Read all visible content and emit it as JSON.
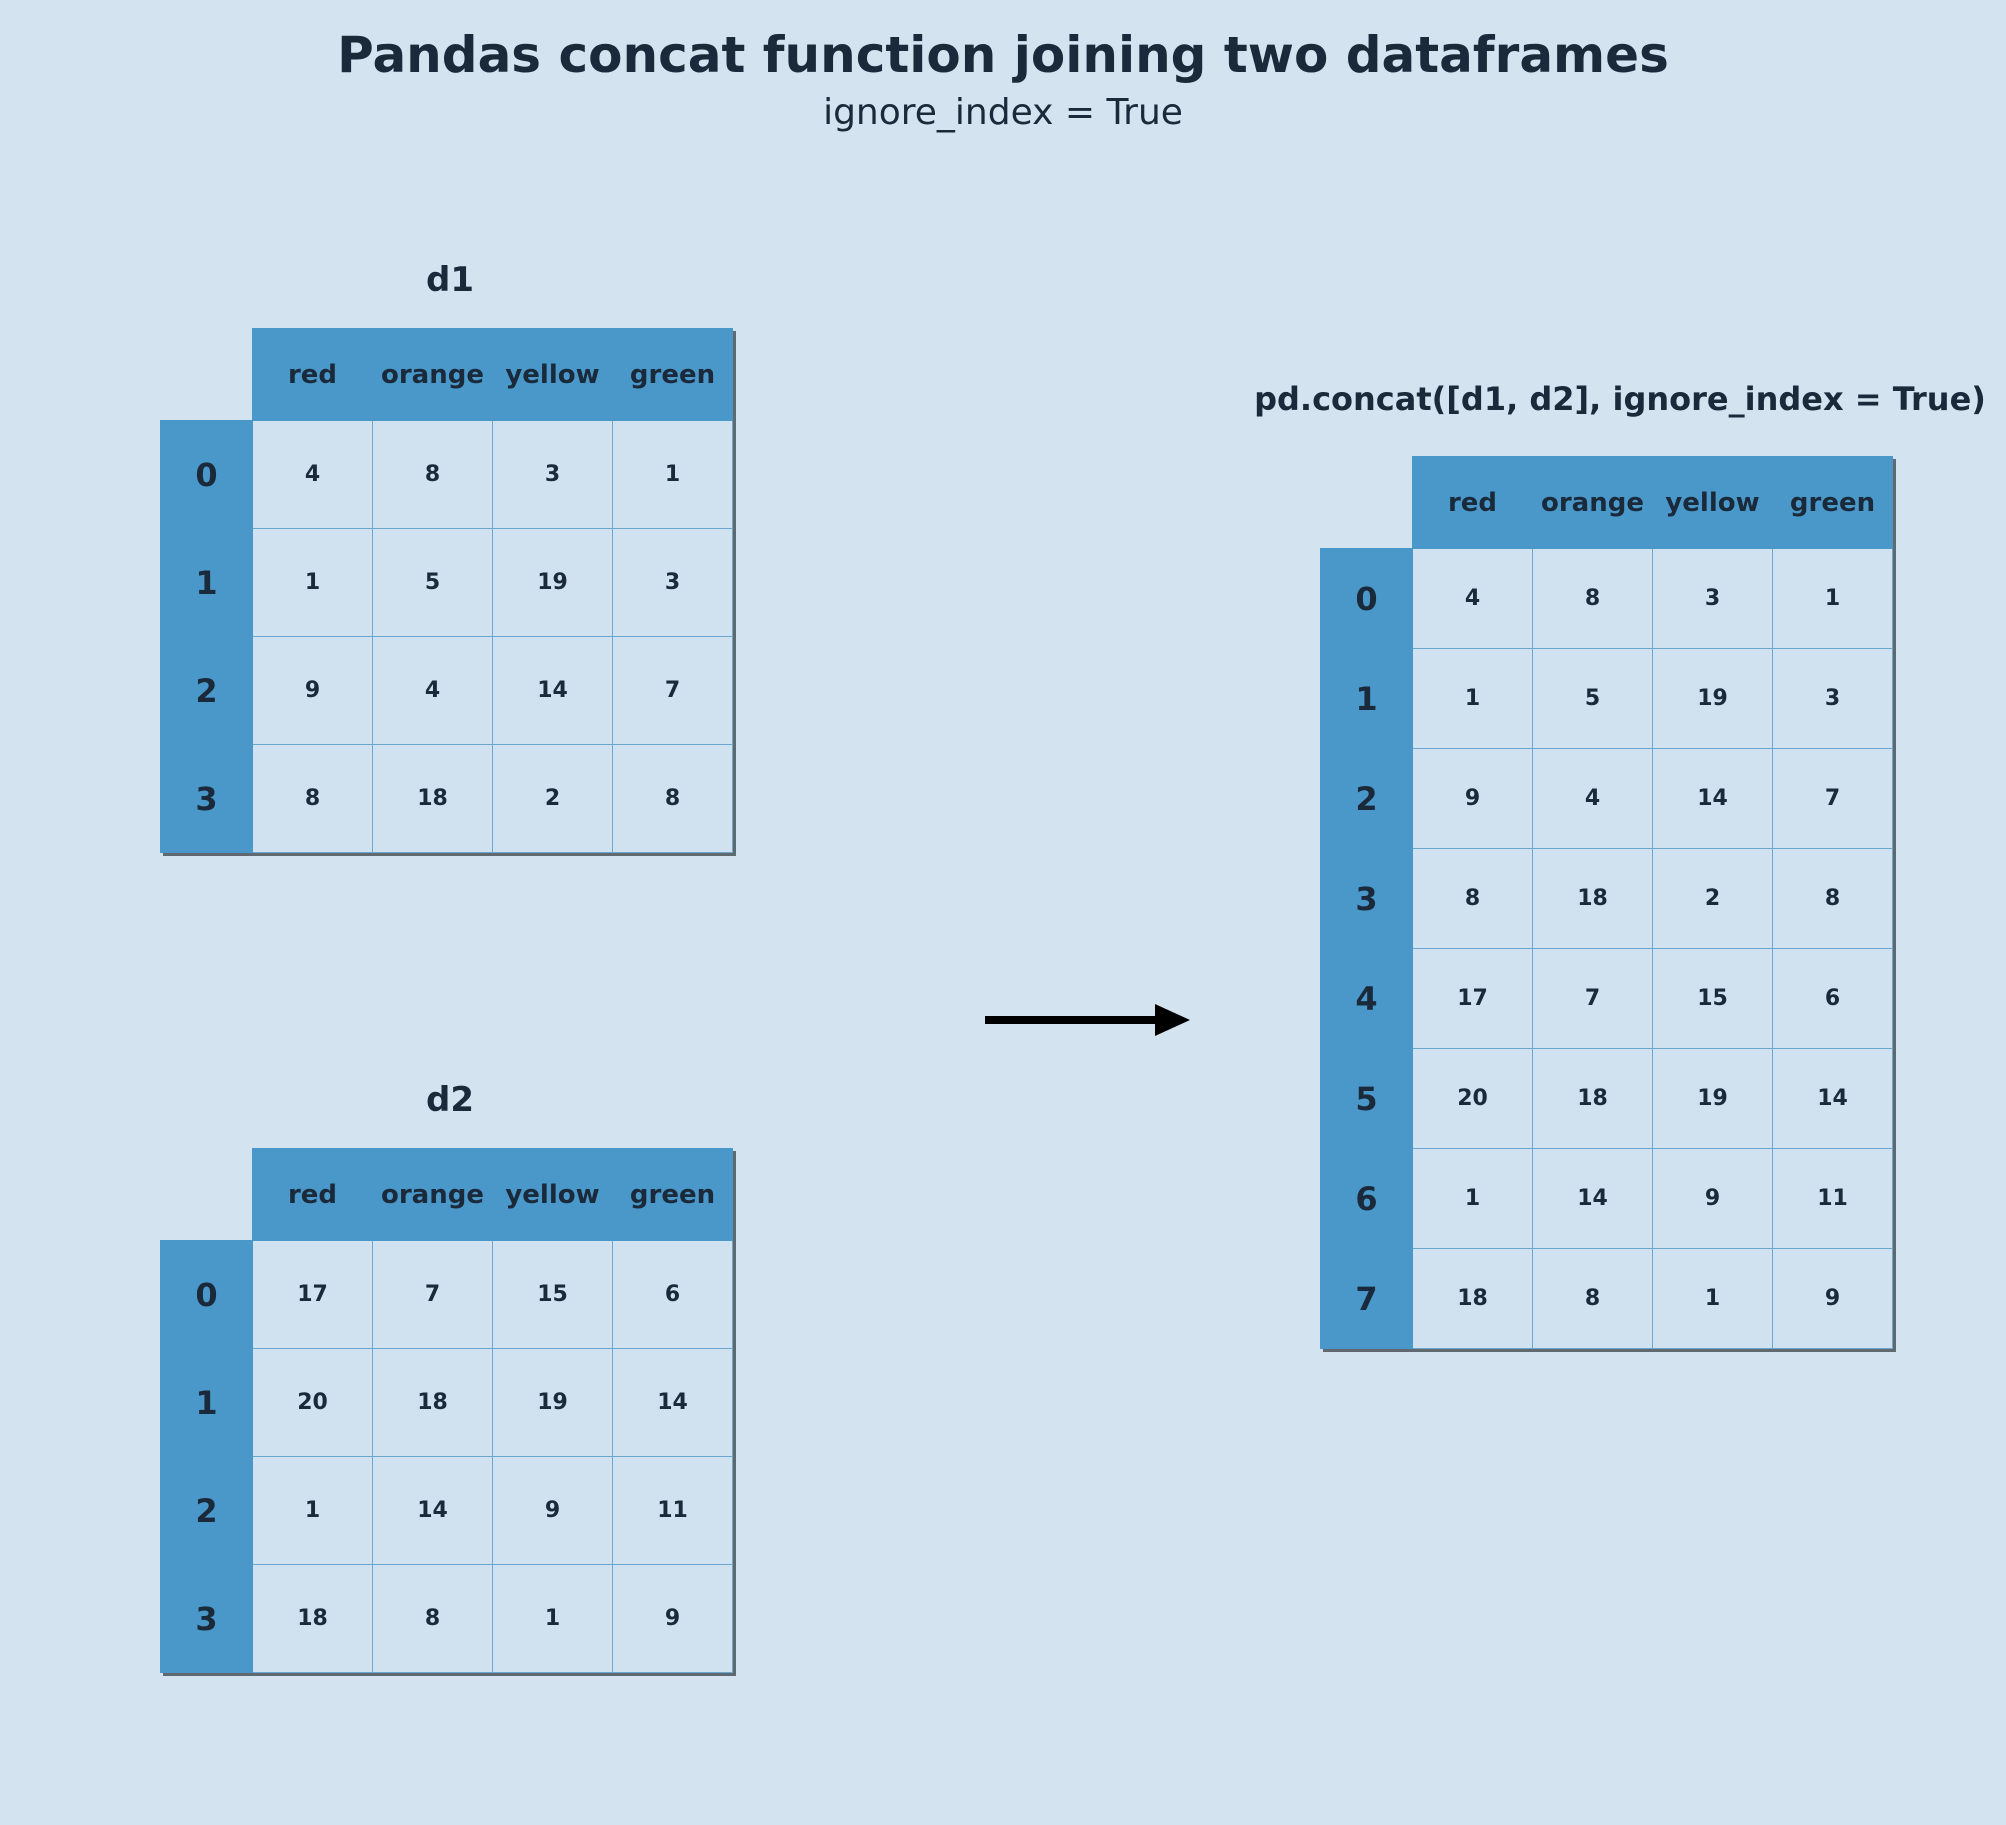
{
  "title": "Pandas concat function joining two dataframes",
  "subtitle": "ignore_index = True",
  "columns": [
    "red",
    "orange",
    "yellow",
    "green"
  ],
  "d1": {
    "label": "d1",
    "index": [
      "0",
      "1",
      "2",
      "3"
    ],
    "rows": [
      [
        "4",
        "8",
        "3",
        "1"
      ],
      [
        "1",
        "5",
        "19",
        "3"
      ],
      [
        "9",
        "4",
        "14",
        "7"
      ],
      [
        "8",
        "18",
        "2",
        "8"
      ]
    ]
  },
  "d2": {
    "label": "d2",
    "index": [
      "0",
      "1",
      "2",
      "3"
    ],
    "rows": [
      [
        "17",
        "7",
        "15",
        "6"
      ],
      [
        "20",
        "18",
        "19",
        "14"
      ],
      [
        "1",
        "14",
        "9",
        "11"
      ],
      [
        "18",
        "8",
        "1",
        "9"
      ]
    ]
  },
  "result": {
    "label": "pd.concat([d1, d2], ignore_index = True)",
    "index": [
      "0",
      "1",
      "2",
      "3",
      "4",
      "5",
      "6",
      "7"
    ],
    "rows": [
      [
        "4",
        "8",
        "3",
        "1"
      ],
      [
        "1",
        "5",
        "19",
        "3"
      ],
      [
        "9",
        "4",
        "14",
        "7"
      ],
      [
        "8",
        "18",
        "2",
        "8"
      ],
      [
        "17",
        "7",
        "15",
        "6"
      ],
      [
        "20",
        "18",
        "19",
        "14"
      ],
      [
        "1",
        "14",
        "9",
        "11"
      ],
      [
        "18",
        "8",
        "1",
        "9"
      ]
    ]
  },
  "chart_data": {
    "type": "table",
    "description": "Illustration of pandas pd.concat joining d1 and d2 row-wise with ignore_index=True producing a new 0..7 integer index.",
    "columns": [
      "red",
      "orange",
      "yellow",
      "green"
    ],
    "inputs": {
      "d1": [
        {
          "red": 4,
          "orange": 8,
          "yellow": 3,
          "green": 1
        },
        {
          "red": 1,
          "orange": 5,
          "yellow": 19,
          "green": 3
        },
        {
          "red": 9,
          "orange": 4,
          "yellow": 14,
          "green": 7
        },
        {
          "red": 8,
          "orange": 18,
          "yellow": 2,
          "green": 8
        }
      ],
      "d2": [
        {
          "red": 17,
          "orange": 7,
          "yellow": 15,
          "green": 6
        },
        {
          "red": 20,
          "orange": 18,
          "yellow": 19,
          "green": 14
        },
        {
          "red": 1,
          "orange": 14,
          "yellow": 9,
          "green": 11
        },
        {
          "red": 18,
          "orange": 8,
          "yellow": 1,
          "green": 9
        }
      ]
    },
    "output": [
      {
        "red": 4,
        "orange": 8,
        "yellow": 3,
        "green": 1
      },
      {
        "red": 1,
        "orange": 5,
        "yellow": 19,
        "green": 3
      },
      {
        "red": 9,
        "orange": 4,
        "yellow": 14,
        "green": 7
      },
      {
        "red": 8,
        "orange": 18,
        "yellow": 2,
        "green": 8
      },
      {
        "red": 17,
        "orange": 7,
        "yellow": 15,
        "green": 6
      },
      {
        "red": 20,
        "orange": 18,
        "yellow": 19,
        "green": 14
      },
      {
        "red": 1,
        "orange": 14,
        "yellow": 9,
        "green": 11
      },
      {
        "red": 18,
        "orange": 8,
        "yellow": 1,
        "green": 9
      }
    ]
  }
}
